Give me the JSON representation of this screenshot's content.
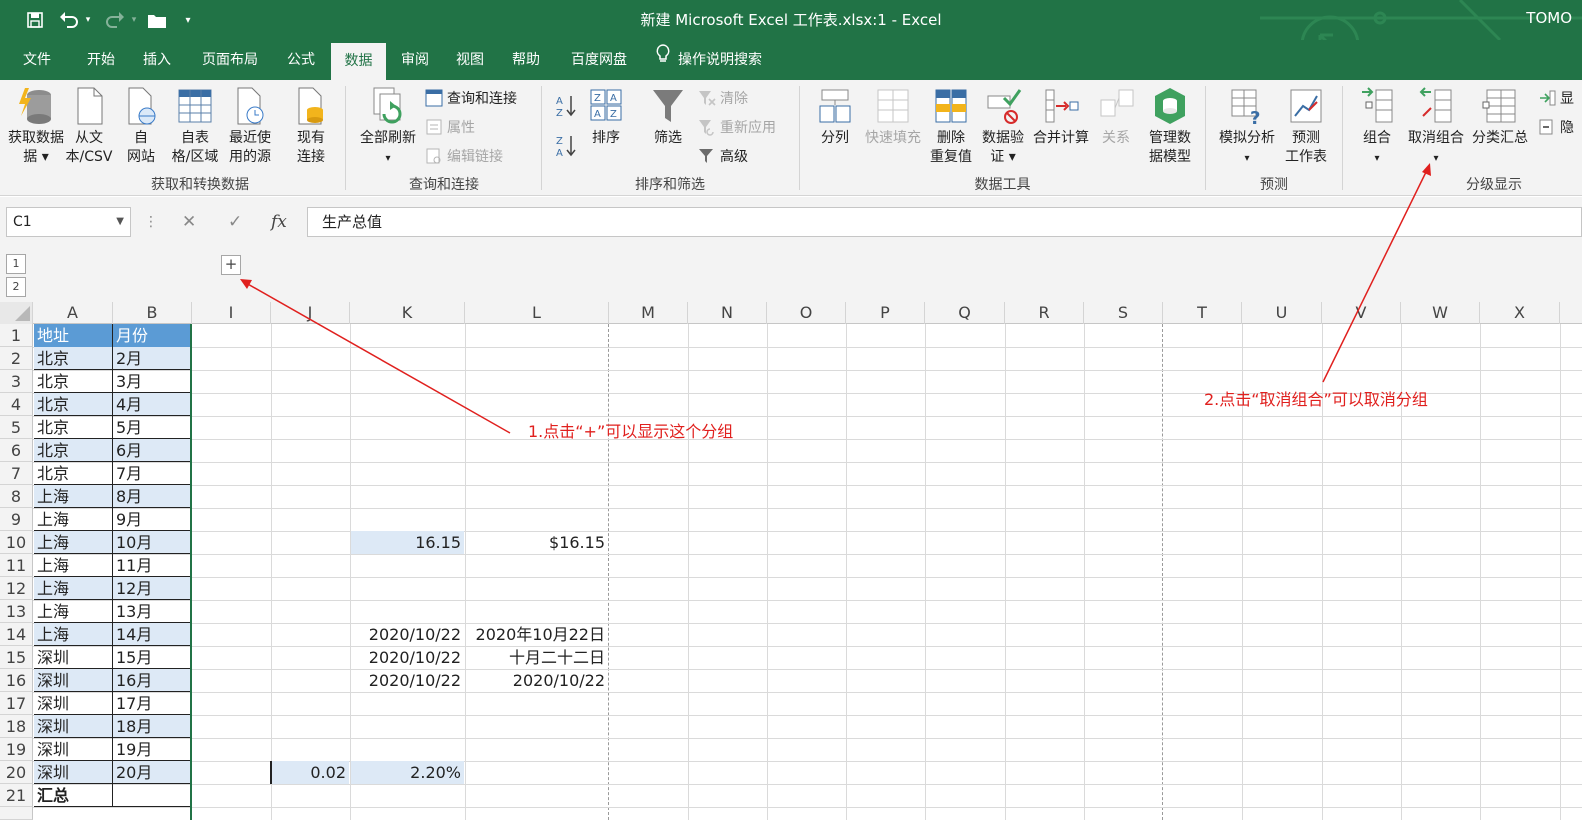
{
  "titlebar": {
    "title": "新建 Microsoft Excel 工作表.xlsx:1  -  Excel",
    "user": "TOMO",
    "save_icon": "save-icon",
    "undo_icon": "undo-icon",
    "redo_icon": "redo-icon",
    "folder_icon": "open-folder-icon",
    "customize_icon": "customize-qat-icon"
  },
  "tabs": [
    "文件",
    "开始",
    "插入",
    "页面布局",
    "公式",
    "数据",
    "审阅",
    "视图",
    "帮助",
    "百度网盘",
    "操作说明搜索"
  ],
  "active_tab": "数据",
  "ribbon": {
    "get_data": "获取数据",
    "get_data_2": "据 ▾",
    "from_csv": "从文",
    "from_csv_2": "本/CSV",
    "from_web": "自",
    "from_web_2": "网站",
    "from_table": "自表",
    "from_table_2": "格/区域",
    "recent_sources": "最近使",
    "recent_sources_2": "用的源",
    "existing_conn": "现有",
    "existing_conn_2": "连接",
    "group_get": "获取和转换数据",
    "refresh_all": "全部刷新",
    "refresh_all_2": "▾",
    "queries_conn": "查询和连接",
    "properties": "属性",
    "edit_links": "编辑链接",
    "group_queries": "查询和连接",
    "sort": "排序",
    "filter": "筛选",
    "clear": "清除",
    "reapply": "重新应用",
    "advanced": "高级",
    "group_sort": "排序和筛选",
    "text_to_cols": "分列",
    "flash_fill": "快速填充",
    "remove_dup": "删除",
    "remove_dup_2": "重复值",
    "data_valid": "数据验",
    "data_valid_2": "证 ▾",
    "consolidate": "合并计算",
    "relations": "关系",
    "data_model": "管理数",
    "data_model_2": "据模型",
    "group_tools": "数据工具",
    "what_if": "模拟分析",
    "what_if_2": "▾",
    "forecast": "预测",
    "forecast_2": "工作表",
    "group_forecast": "预测",
    "group_btn": "组合",
    "group_btn_2": "▾",
    "ungroup": "取消组合",
    "ungroup_2": "▾",
    "subtotal": "分类汇总",
    "show_detail": "显",
    "hide_detail": "隐",
    "group_outline": "分级显示"
  },
  "formula_bar": {
    "name_box": "C1",
    "formula": "生产总值",
    "cancel": "✕",
    "enter": "✓",
    "fx": "fx"
  },
  "outline": {
    "level1": "1",
    "level2": "2",
    "expand": "+"
  },
  "columns": [
    "A",
    "B",
    "I",
    "J",
    "K",
    "L",
    "M",
    "N",
    "O",
    "P",
    "Q",
    "R",
    "S",
    "T",
    "U",
    "V",
    "W",
    "X"
  ],
  "rows": [
    "1",
    "2",
    "3",
    "4",
    "5",
    "6",
    "7",
    "8",
    "9",
    "10",
    "11",
    "12",
    "13",
    "14",
    "15",
    "16",
    "17",
    "18",
    "19",
    "20",
    "21"
  ],
  "colA": [
    "地址",
    "北京",
    "北京",
    "北京",
    "北京",
    "北京",
    "北京",
    "上海",
    "上海",
    "上海",
    "上海",
    "上海",
    "上海",
    "上海",
    "深圳",
    "深圳",
    "深圳",
    "深圳",
    "深圳",
    "深圳",
    "汇总"
  ],
  "colB": [
    "月份",
    "2月",
    "3月",
    "4月",
    "5月",
    "6月",
    "7月",
    "8月",
    "9月",
    "10月",
    "11月",
    "12月",
    "13月",
    "14月",
    "15月",
    "16月",
    "17月",
    "18月",
    "19月",
    "20月",
    ""
  ],
  "cells": {
    "k10": "16.15",
    "l10": "$16.15",
    "k14": "2020/10/22",
    "l14": "2020年10月22日",
    "k15": "2020/10/22",
    "l15": "十月二十二日",
    "k16": "2020/10/22",
    "l16": "2020/10/22",
    "j20": "0.02",
    "k20": "2.20%"
  },
  "annotations": {
    "a1": "1.点击“+”可以显示这个分组",
    "a2": "2.点击“取消组合”可以取消分组",
    "color": "#e0201e"
  },
  "colors": {
    "excel_green": "#217346",
    "header_blue": "#5b9bd5",
    "band_blue": "#dde9f6"
  }
}
